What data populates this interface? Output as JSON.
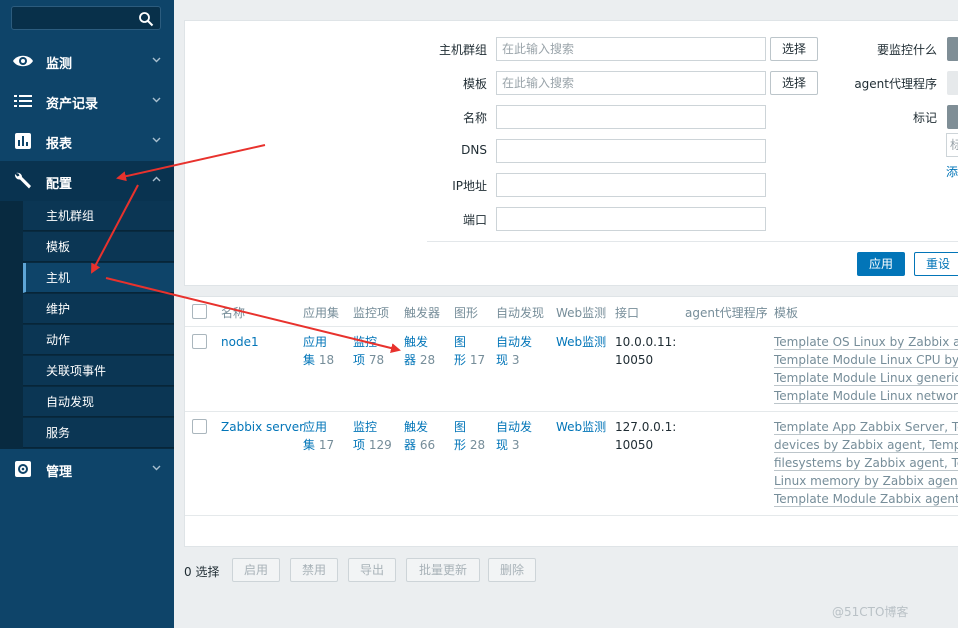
{
  "sidebar": {
    "search_placeholder": "",
    "items": [
      {
        "label": "监测",
        "icon": "eye-icon"
      },
      {
        "label": "资产记录",
        "icon": "list-icon"
      },
      {
        "label": "报表",
        "icon": "bar-chart-icon"
      },
      {
        "label": "配置",
        "icon": "wrench-icon"
      },
      {
        "label": "管理",
        "icon": "gear-icon"
      }
    ],
    "config_submenu": [
      "主机群组",
      "模板",
      "主机",
      "维护",
      "动作",
      "关联项事件",
      "自动发现",
      "服务"
    ],
    "active_submenu": "主机"
  },
  "filter": {
    "host_group_label": "主机群组",
    "host_group_placeholder": "在此输入搜索",
    "template_label": "模板",
    "template_placeholder": "在此输入搜索",
    "select_label": "选择",
    "name_label": "名称",
    "dns_label": "DNS",
    "ip_label": "IP地址",
    "port_label": "端口",
    "monitored_by_label": "要监控什么",
    "proxy_label": "agent代理程序",
    "tags_label": "标记",
    "tag_input_partial": "标",
    "add_link_partial": "添",
    "apply_label": "应用",
    "reset_label": "重设"
  },
  "table": {
    "headers": [
      "名称",
      "应用集",
      "监控项",
      "触发器",
      "图形",
      "自动发现",
      "Web监测",
      "接口",
      "agent代理程序",
      "模板"
    ],
    "rows": [
      {
        "name": "node1",
        "app_label_1": "应用",
        "app_label_2": "集",
        "app_count": "18",
        "item_label_1": "监控",
        "item_label_2": "项",
        "item_count": "78",
        "trigger_label_1": "触发",
        "trigger_label_2": "器",
        "trigger_count": "28",
        "graph_label_1": "图",
        "graph_label_2": "形",
        "graph_count": "17",
        "disc_label_1": "自动发",
        "disc_label_2": "现",
        "disc_count": "3",
        "web": "Web监测",
        "interface_1": "10.0.0.11:",
        "interface_2": "10050",
        "templates": [
          "Template OS Linux by Zabbix agen",
          "Template Module Linux CPU by Za",
          "Template Module Linux generic by",
          "Template Module Linux network int"
        ]
      },
      {
        "name": "Zabbix server",
        "app_label_1": "应用",
        "app_label_2": "集",
        "app_count": "17",
        "item_label_1": "监控",
        "item_label_2": "项",
        "item_count": "129",
        "trigger_label_1": "触发",
        "trigger_label_2": "器",
        "trigger_count": "66",
        "graph_label_1": "图",
        "graph_label_2": "形",
        "graph_count": "28",
        "disc_label_1": "自动发",
        "disc_label_2": "现",
        "disc_count": "3",
        "web": "Web监测",
        "interface_1": "127.0.0.1:",
        "interface_2": "10050",
        "templates": [
          "Template App Zabbix Server, Temp",
          "devices by Zabbix agent, Template",
          "filesystems by Zabbix agent, Temp",
          "Linux memory by Zabbix agent, Te",
          "Template Module Zabbix agent)"
        ]
      }
    ]
  },
  "footer": {
    "selected": "0 选择",
    "actions": [
      "启用",
      "禁用",
      "导出",
      "批量更新",
      "删除"
    ]
  },
  "watermark": "@51CTO博客",
  "colors": {
    "sidebar": "#0e4469",
    "accent": "#0275b8",
    "arrow": "#e8322d"
  }
}
